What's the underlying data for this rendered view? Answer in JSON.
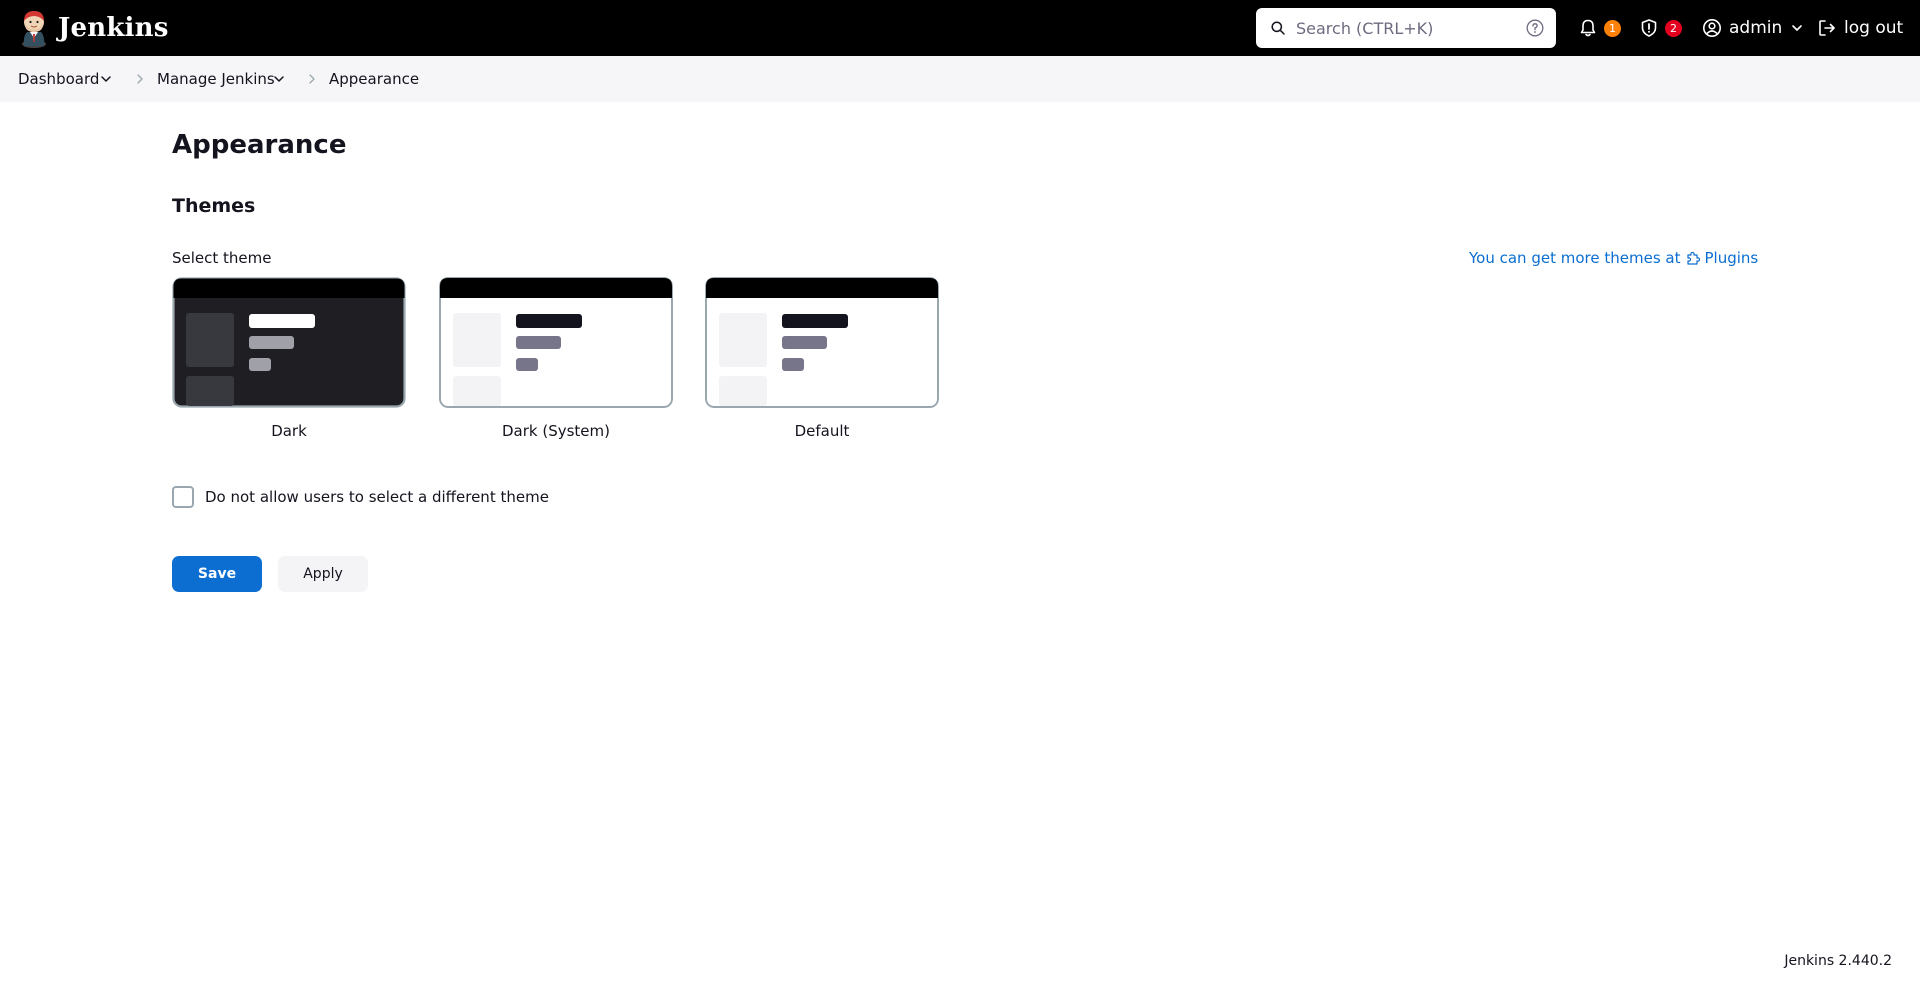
{
  "header": {
    "brand_name": "Jenkins",
    "search": {
      "placeholder": "Search (CTRL+K)",
      "value": ""
    },
    "notifications": {
      "icon": "bell-icon",
      "count": "1",
      "badge_color": "#fe820a"
    },
    "security": {
      "icon": "shield-alert-icon",
      "count": "2",
      "badge_color": "#e6001f"
    },
    "user": {
      "icon": "user-circle-icon",
      "name": "admin"
    },
    "logout_label": "log out"
  },
  "breadcrumbs": {
    "items": [
      {
        "label": "Dashboard",
        "has_menu": true
      },
      {
        "label": "Manage Jenkins",
        "has_menu": true
      },
      {
        "label": "Appearance",
        "has_menu": false
      }
    ]
  },
  "main": {
    "page_title": "Appearance",
    "section_title": "Themes",
    "select_label": "Select theme",
    "more_themes_text": "You can get more themes at",
    "more_themes_link": "Plugins",
    "themes": [
      {
        "label": "Dark",
        "selected": true
      },
      {
        "label": "Dark (System)",
        "selected": false
      },
      {
        "label": "Default",
        "selected": false
      }
    ],
    "disallow_checkbox": {
      "label": "Do not allow users to select a different theme",
      "checked": false
    },
    "save_label": "Save",
    "apply_label": "Apply"
  },
  "footer": {
    "version": "Jenkins 2.440.2"
  },
  "colors": {
    "accent": "#0b6ed0",
    "header_bg": "#000000",
    "breadcrumb_bg": "#f6f6f8",
    "dark_theme_bg": "#1f1f23"
  }
}
